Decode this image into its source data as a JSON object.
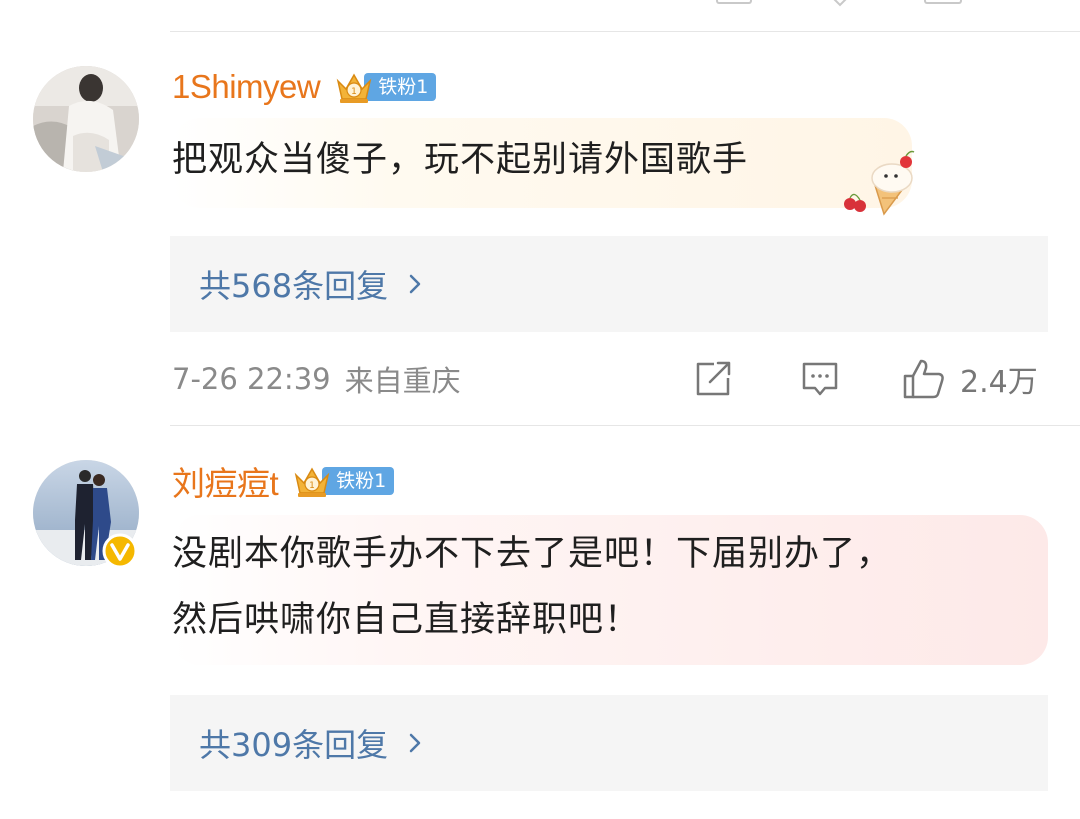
{
  "comments": [
    {
      "username": "1Shimyew",
      "badge": "铁粉1",
      "text": "把观众当傻子，玩不起别请外国歌手",
      "replies_label": "共568条回复",
      "time": "7-26 22:39",
      "location": "来自重庆",
      "likes": "2.4万"
    },
    {
      "username": "刘痘痘t",
      "badge": "铁粉1",
      "text_line1": "没剧本你歌手办不下去了是吧！下届别办了，",
      "text_line2": "然后哄啸你自己直接辞职吧！",
      "replies_label": "共309条回复"
    }
  ],
  "colors": {
    "username": "#e8761c",
    "reply_link": "#4e78a8",
    "badge_bg": "#5fa6e3",
    "verified": "#f5b800",
    "meta": "#8a8a8a"
  },
  "icons": [
    "repost-icon",
    "comment-icon",
    "like-icon",
    "chevron-right-icon",
    "crown-badge-icon",
    "verified-icon",
    "ice-cream-sticker-icon"
  ]
}
